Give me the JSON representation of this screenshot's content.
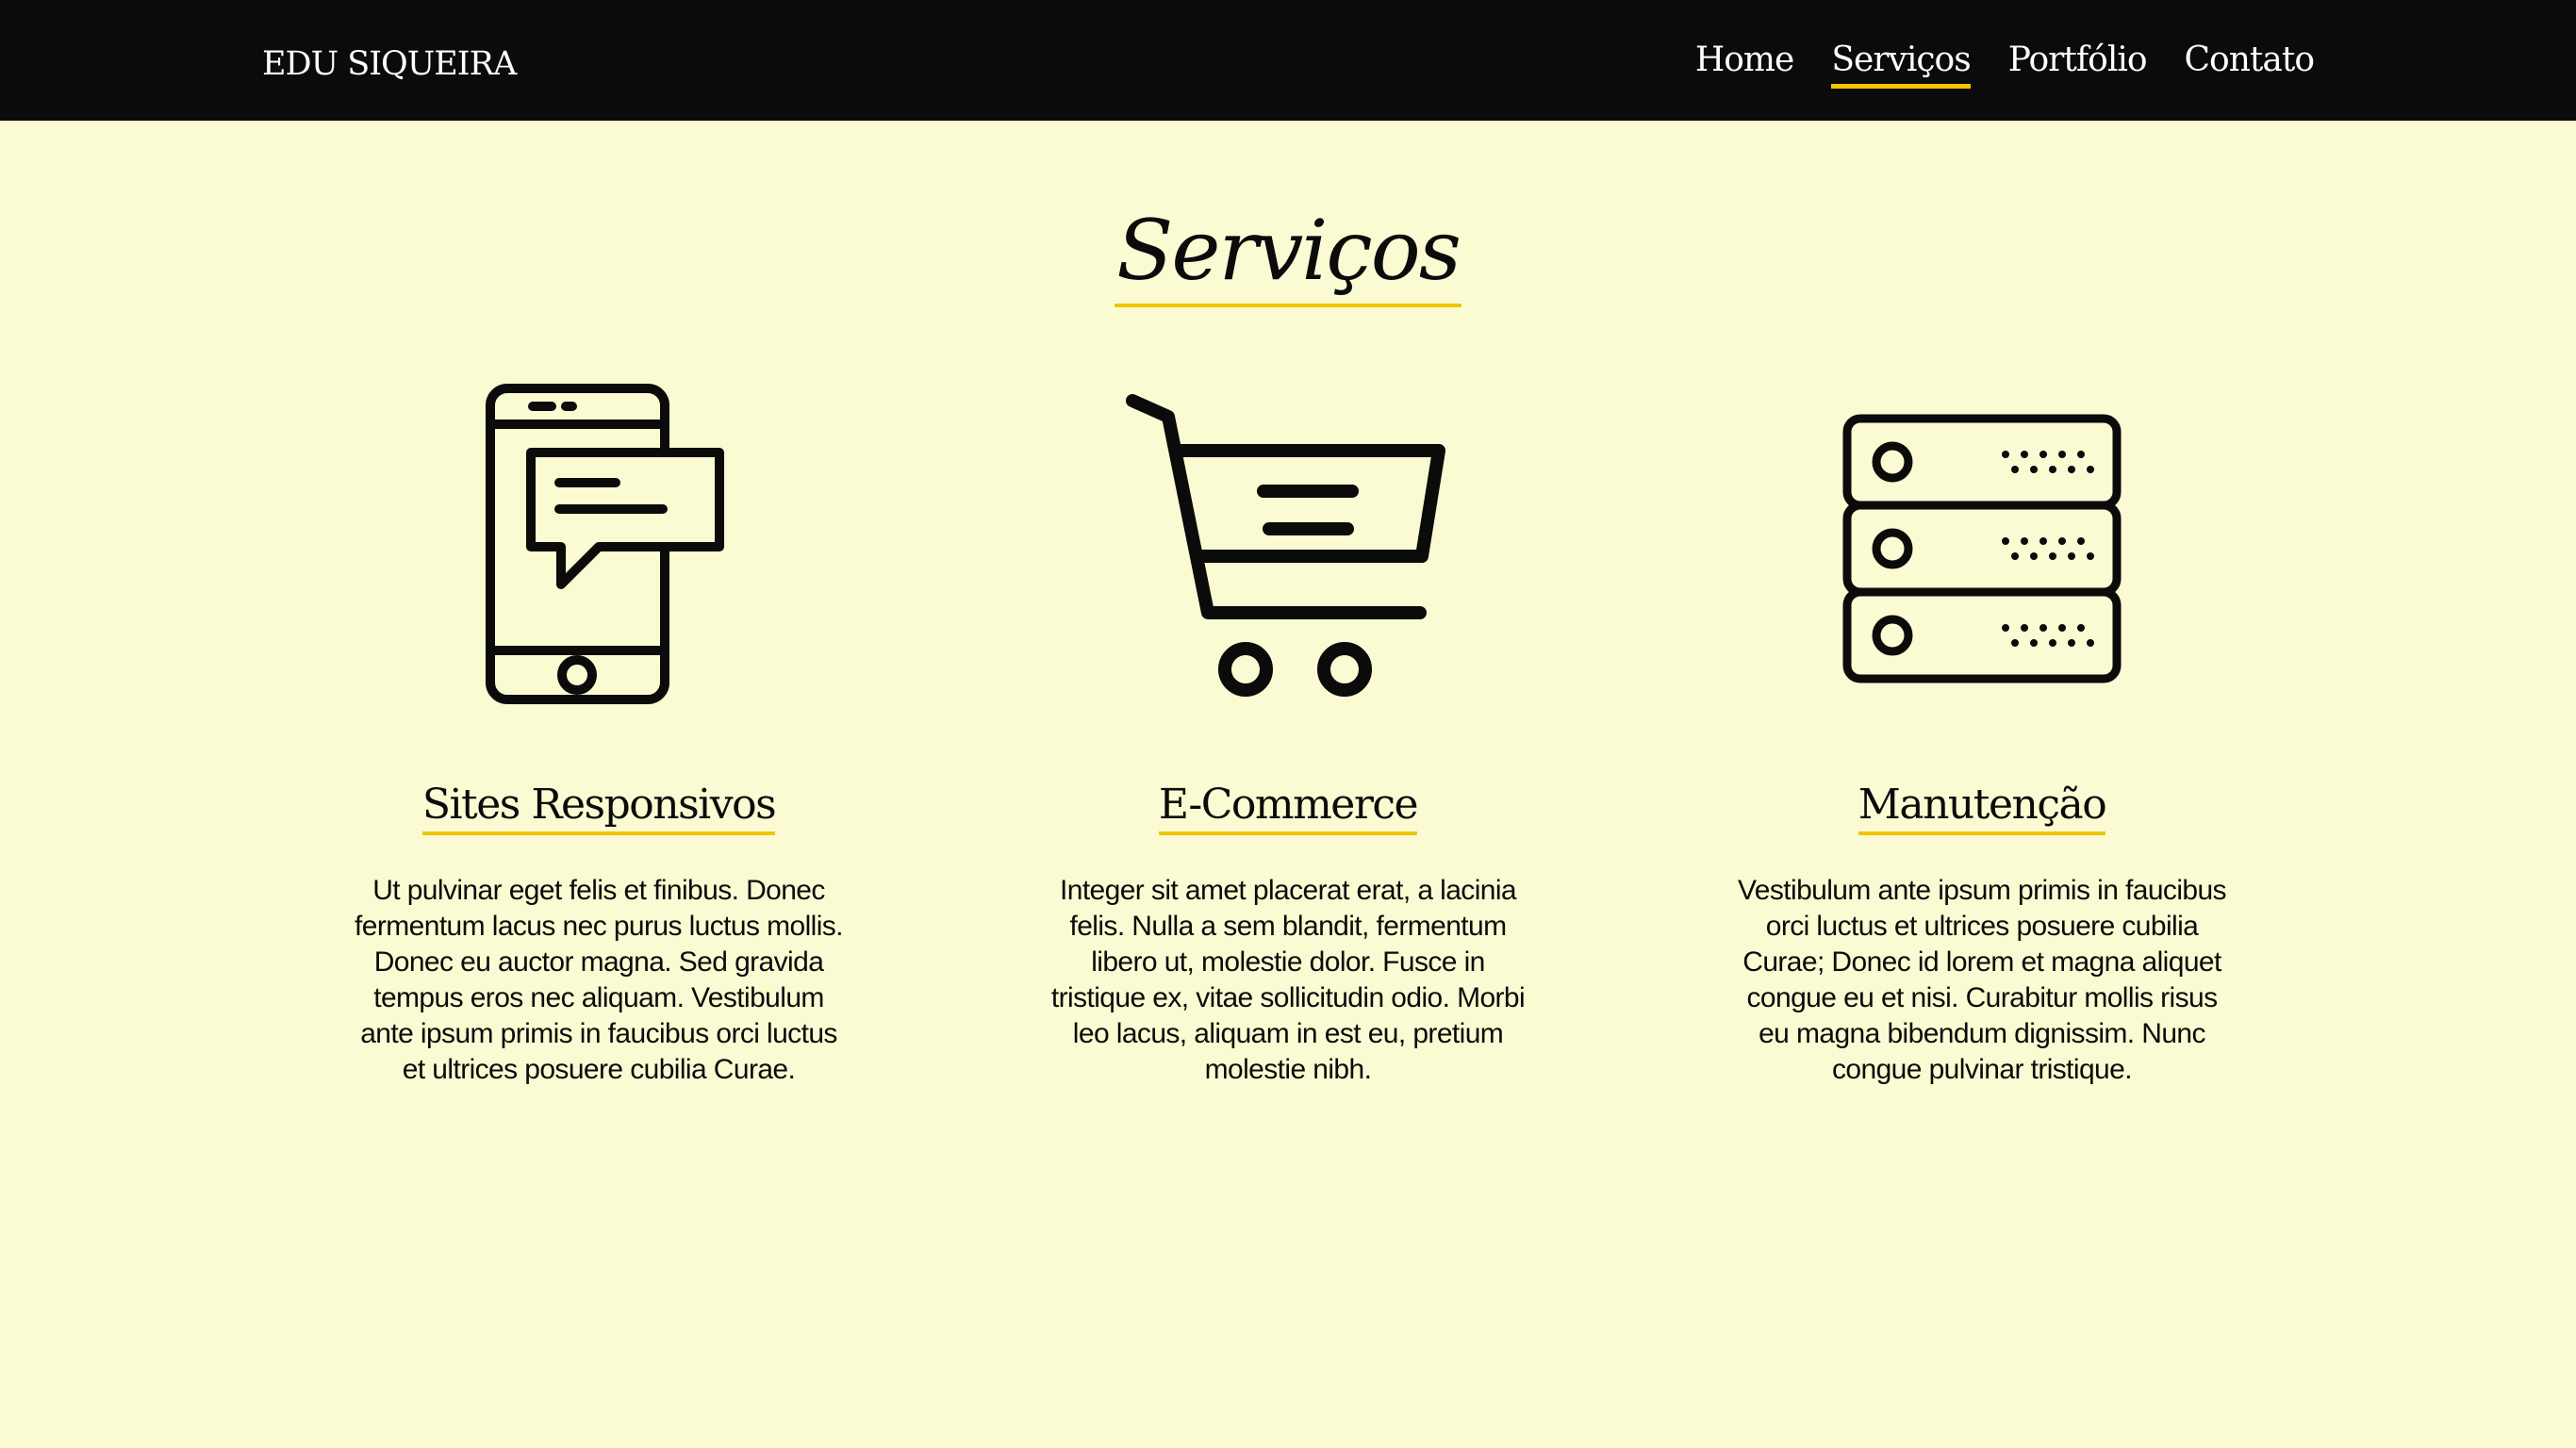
{
  "header": {
    "brand": "EDU SIQUEIRA",
    "nav": [
      {
        "label": "Home",
        "active": false
      },
      {
        "label": "Serviços",
        "active": true
      },
      {
        "label": "Portfólio",
        "active": false
      },
      {
        "label": "Contato",
        "active": false
      }
    ]
  },
  "main": {
    "title": "Serviços",
    "services": [
      {
        "icon": "smartphone-message-icon",
        "title": "Sites Responsivos",
        "text": "Ut pulvinar eget felis et finibus. Donec fermentum lacus nec purus luctus mollis. Donec eu auctor magna. Sed gravida tempus eros nec aliquam. Vestibulum ante ipsum primis in faucibus orci luctus et ultrices posuere cubilia Curae."
      },
      {
        "icon": "shopping-cart-icon",
        "title": "E-Commerce",
        "text": "Integer sit amet placerat erat, a lacinia felis. Nulla a sem blandit, fermentum libero ut, molestie dolor. Fusce in tristique ex, vitae sollicitudin odio. Morbi leo lacus, aliquam in est eu, pretium molestie nibh."
      },
      {
        "icon": "server-icon",
        "title": "Manutenção",
        "text": "Vestibulum ante ipsum primis in faucibus orci luctus et ultrices posuere cubilia Curae; Donec id lorem et magna aliquet congue eu et nisi. Curabitur mollis risus eu magna bibendum dignissim. Nunc congue pulvinar tristique."
      }
    ]
  },
  "colors": {
    "background": "#fafbd2",
    "navbar": "#0b0b0b",
    "accent": "#f2c500",
    "text": "#0b0b0b"
  }
}
